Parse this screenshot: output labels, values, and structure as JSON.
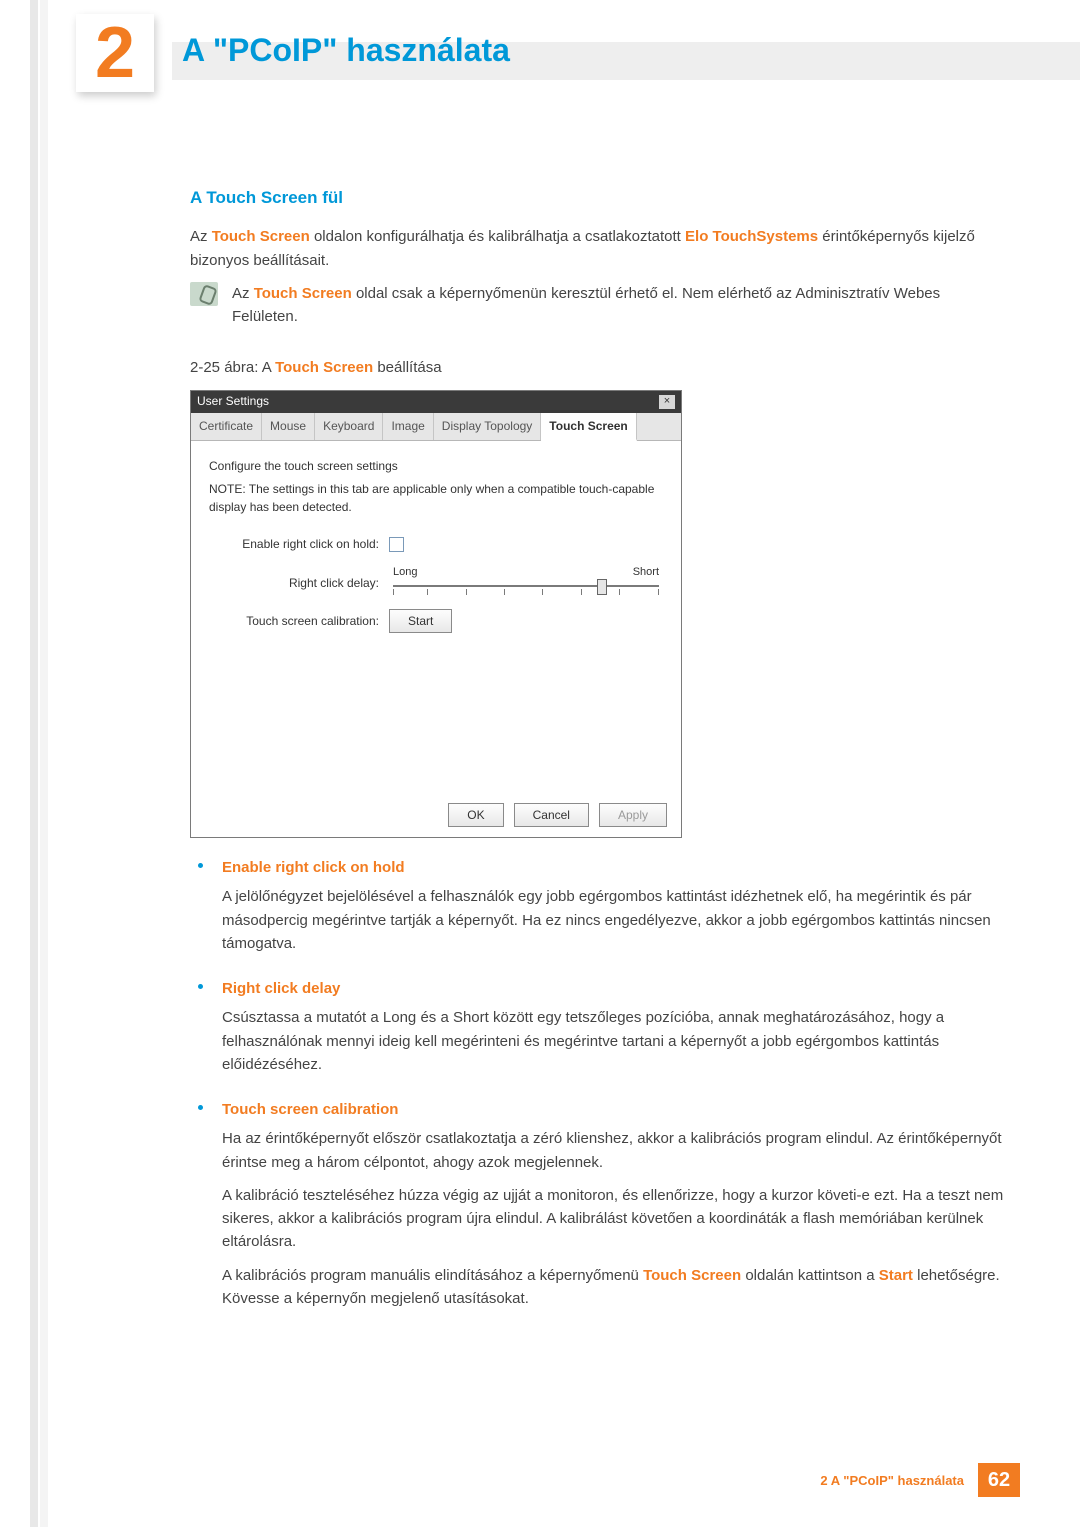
{
  "chapter": {
    "number": "2",
    "title": "A \"PCoIP\" használata"
  },
  "section": {
    "heading": "A Touch Screen fül",
    "intro": [
      {
        "text": "Az "
      },
      {
        "text": "Touch Screen",
        "cls": "orange"
      },
      {
        "text": " oldalon konfigurálhatja és kalibrálhatja a csatlakoztatott "
      },
      {
        "text": " Elo TouchSystems",
        "cls": "orange"
      },
      {
        "text": " érintőképernyős kijelző bizonyos beállításait."
      }
    ],
    "note": [
      {
        "text": "Az "
      },
      {
        "text": "Touch Screen",
        "cls": "orange"
      },
      {
        "text": " oldal csak a képernyőmenün keresztül érhető el. Nem elérhető az Adminisztratív Webes Felületen."
      }
    ],
    "figure_caption": [
      {
        "text": "2-25 ábra: A "
      },
      {
        "text": "Touch Screen",
        "cls": "orange"
      },
      {
        "text": " beállítása"
      }
    ]
  },
  "dialog": {
    "title": "User Settings",
    "tabs": [
      "Certificate",
      "Mouse",
      "Keyboard",
      "Image",
      "Display Topology",
      "Touch Screen"
    ],
    "body_heading": "Configure the touch screen settings",
    "body_note": "NOTE: The settings in this tab are applicable only when a compatible touch-capable display has been detected.",
    "rows": {
      "enable_label": "Enable right click on hold:",
      "delay_label": "Right click delay:",
      "delay_long": "Long",
      "delay_short": "Short",
      "calib_label": "Touch screen calibration:",
      "start_btn": "Start"
    },
    "buttons": {
      "ok": "OK",
      "cancel": "Cancel",
      "apply": "Apply"
    }
  },
  "features": [
    {
      "title": "Enable right click on hold",
      "paras": [
        [
          {
            "text": "A jelölőnégyzet bejelölésével a felhasználók egy jobb egérgombos kattintást idézhetnek elő, ha megérintik és pár másodpercig megérintve tartják a képernyőt. Ha ez nincs engedélyezve, akkor a jobb egérgombos kattintás nincsen támogatva."
          }
        ]
      ]
    },
    {
      "title": "Right click delay",
      "paras": [
        [
          {
            "text": "Csúsztassa a mutatót a Long és a Short között egy tetszőleges pozícióba, annak meghatározásához, hogy a felhasználónak mennyi ideig kell megérinteni és megérintve tartani a képernyőt a jobb egérgombos kattintás előidézéséhez."
          }
        ]
      ]
    },
    {
      "title": "Touch screen calibration",
      "paras": [
        [
          {
            "text": "Ha az érintőképernyőt először csatlakoztatja a zéró klienshez, akkor a kalibrációs program elindul. Az érintőképernyőt érintse meg a három célpontot, ahogy azok megjelennek."
          }
        ],
        [
          {
            "text": "A kalibráció teszteléséhez húzza végig az ujját a monitoron, és ellenőrizze, hogy a kurzor követi-e ezt. Ha a teszt nem sikeres, akkor a kalibrációs program újra elindul. A kalibrálást követően a koordináták a flash memóriában kerülnek eltárolásra."
          }
        ],
        [
          {
            "text": "A kalibrációs program manuális elindításához a képernyőmenü "
          },
          {
            "text": "Touch Screen",
            "cls": "orange"
          },
          {
            "text": " oldalán kattintson a "
          },
          {
            "text": "Start",
            "cls": "orange"
          },
          {
            "text": " lehetőségre. Kövesse a képernyőn megjelenő utasításokat."
          }
        ]
      ]
    }
  ],
  "footer": {
    "label": "2 A \"PCoIP\" használata",
    "page": "62"
  }
}
